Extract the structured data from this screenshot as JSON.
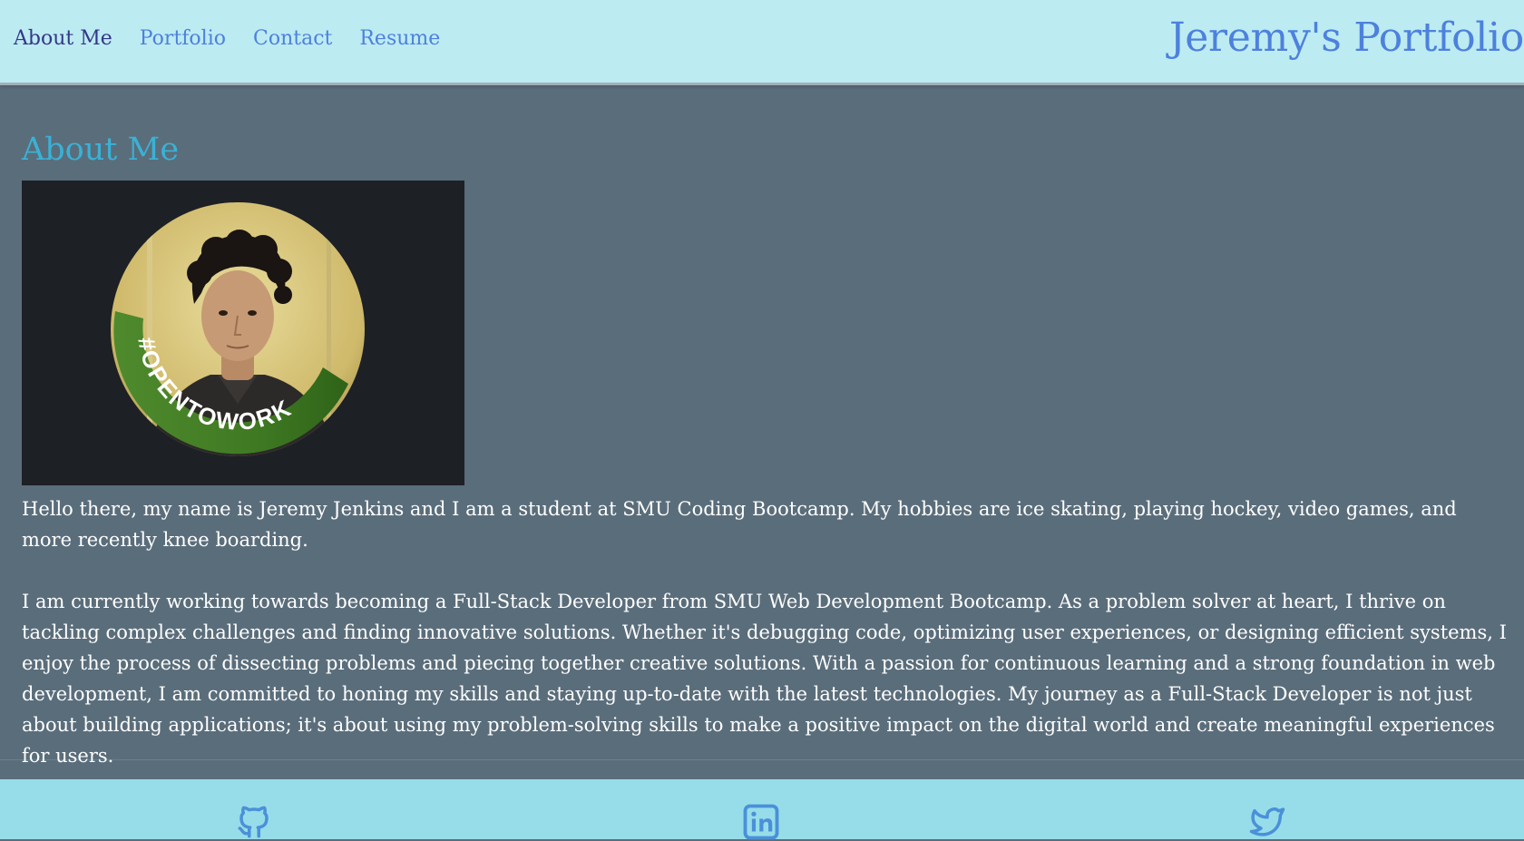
{
  "header": {
    "nav": [
      {
        "label": "About Me"
      },
      {
        "label": "Portfolio"
      },
      {
        "label": "Contact"
      },
      {
        "label": "Resume"
      }
    ],
    "site_title": "Jeremy's Portfolio"
  },
  "about": {
    "title": "About Me",
    "photo_badge_text": "#OPENTOWORK",
    "paragraphs": [
      "Hello there, my name is Jeremy Jenkins and I am a student at SMU Coding Bootcamp. My hobbies are ice skating, playing hockey, video games, and more recently knee boarding.",
      "I am currently working towards becoming a Full-Stack Developer from SMU Web Development Bootcamp. As a problem solver at heart, I thrive on tackling complex challenges and finding innovative solutions. Whether it's debugging code, optimizing user experiences, or designing efficient systems, I enjoy the process of dissecting problems and piecing together creative solutions. With a passion for continuous learning and a strong foundation in web development, I am committed to honing my skills and staying up-to-date with the latest technologies. My journey as a Full-Stack Developer is not just about building applications; it's about using my problem-solving skills to make a positive impact on the digital world and create meaningful experiences for users."
    ]
  },
  "footer": {
    "icons": [
      "github-icon",
      "linkedin-icon",
      "twitter-icon"
    ]
  },
  "colors": {
    "header_bg": "#bdebf2",
    "nav_link": "#4c81dd",
    "nav_active": "#33378a",
    "main_bg": "#5a6d7b",
    "section_title": "#3ab1d6",
    "footer_bg": "#96dde9",
    "footer_icon": "#4a90d9",
    "badge_green": "#4e8a2c"
  }
}
